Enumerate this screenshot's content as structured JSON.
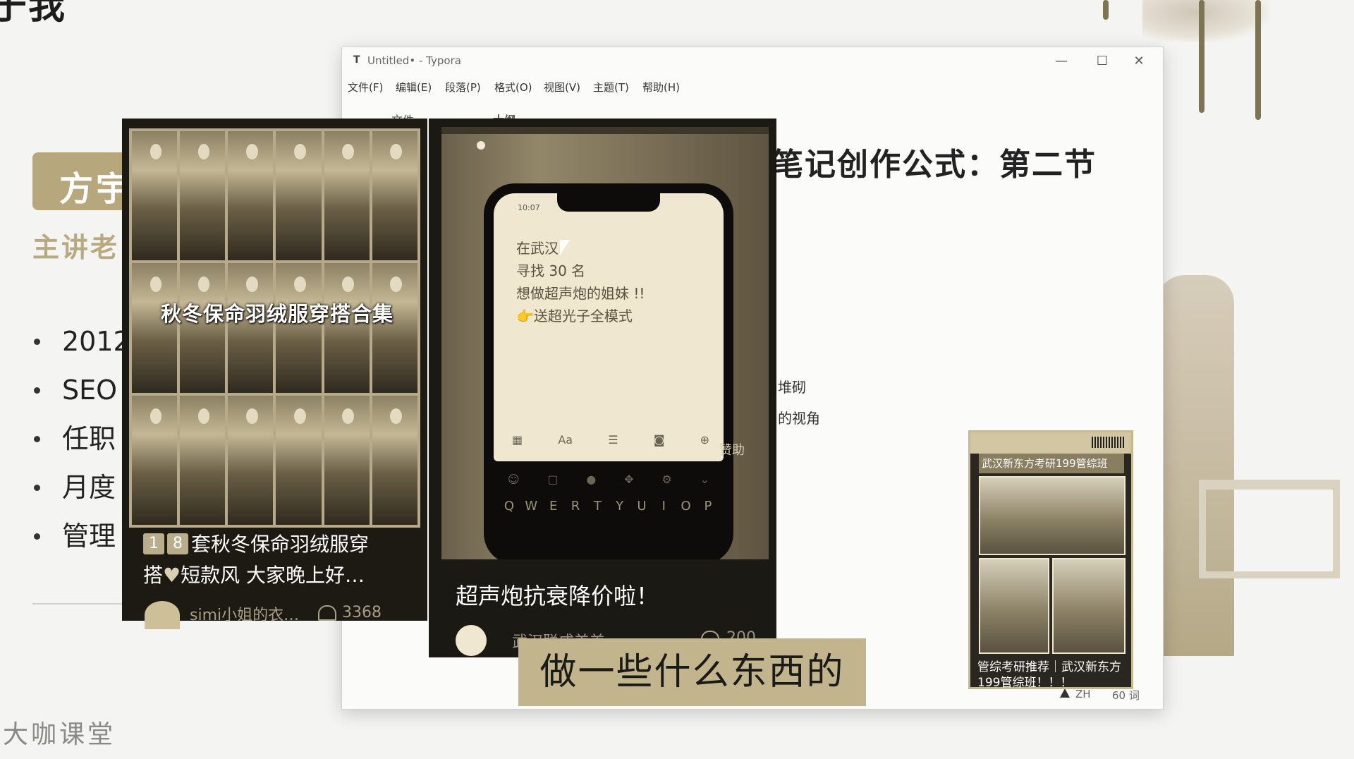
{
  "slide": {
    "top_title": "于我",
    "name_badge": "方宇",
    "lecturer": "主讲老",
    "bullets": [
      "2012",
      "SEO",
      "任职",
      "月度",
      "管理"
    ],
    "watermark": "大咖课堂"
  },
  "typora": {
    "logo": "T",
    "window_title": "Untitled• - Typora",
    "controls": {
      "minimize": "—",
      "maximize": "☐",
      "close": "✕"
    },
    "menu": [
      "文件(F)",
      "编辑(E)",
      "段落(P)",
      "格式(O)",
      "视图(V)",
      "主题(T)",
      "帮助(H)"
    ],
    "sidebar_tabs": [
      "文件",
      "大纲"
    ],
    "heading": "笔记创作公式：第二节",
    "fragments": [
      "堆砌",
      "的视角"
    ],
    "status": {
      "lang": "ZH",
      "words": "60 词",
      "nav_left": "〈",
      "nav_code": "</>"
    }
  },
  "card1": {
    "grid_caption": "秋冬保命羽绒服穿搭合集",
    "badges": [
      "1",
      "8"
    ],
    "title_line1": "套秋冬保命羽绒服穿",
    "title_line2_pre": "搭",
    "title_heart": "♥",
    "title_line2_post": "短款风 大家晚上好…",
    "author": "simi小姐的衣…",
    "likes": "3368"
  },
  "card2": {
    "phone_time": "10:07",
    "note": [
      "在武汉",
      "寻找 30 名",
      "想做超声炮的姐妹 !!",
      "👉送超光子全模式"
    ],
    "toolbar": [
      "▦",
      "Aa",
      "☰",
      "◙",
      "⊕"
    ],
    "keyboard_keys": [
      "Q",
      "W",
      "E",
      "R",
      "T",
      "Y",
      "U",
      "I",
      "O",
      "P"
    ],
    "video_tag": "赞助",
    "title": "超声炮抗衰降价啦！",
    "author": "武汉联成美美",
    "likes": "200"
  },
  "subtitle": "做一些什么东西的",
  "ad": {
    "header": "武汉新东方考研199管综班",
    "caption": "管综考研推荐｜武汉新东方199管综班！！！"
  }
}
